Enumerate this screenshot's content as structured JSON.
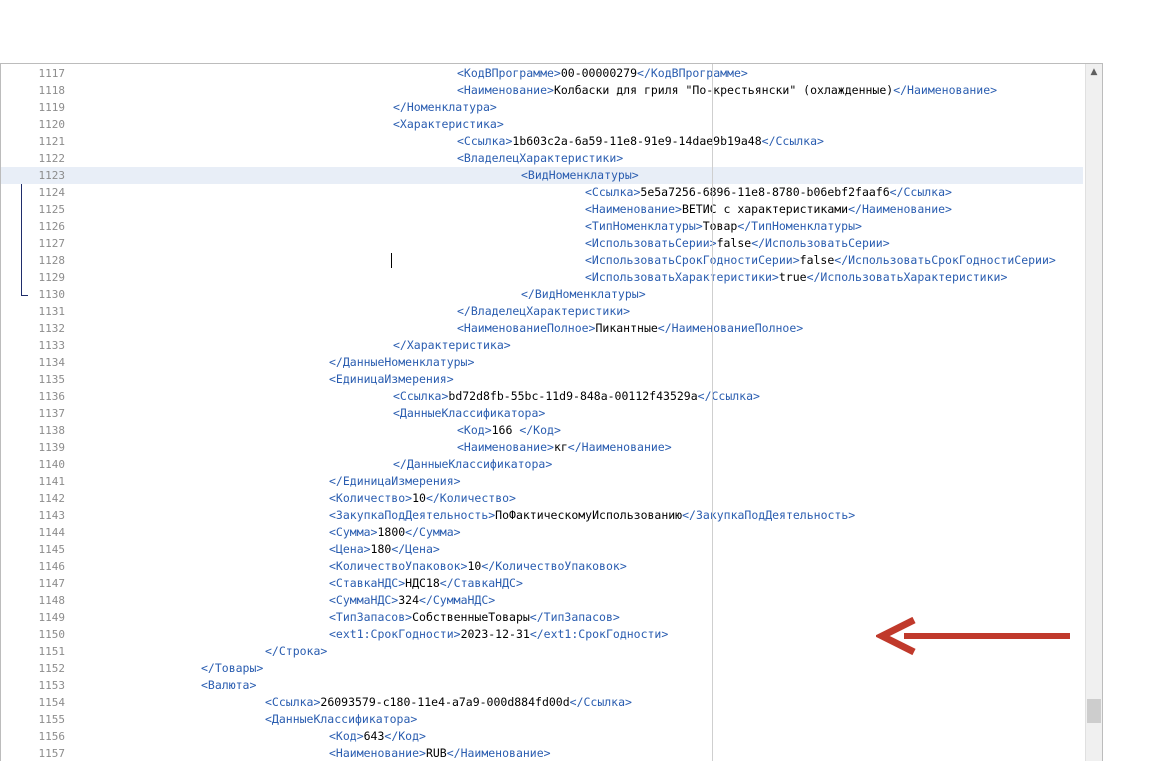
{
  "editor": {
    "lines": [
      {
        "n": "1117",
        "i": 7,
        "segs": [
          [
            "t",
            "<КодВПрограмме>"
          ],
          [
            "x",
            "00-00000279"
          ],
          [
            "t",
            "</КодВПрограмме>"
          ]
        ]
      },
      {
        "n": "1118",
        "i": 7,
        "segs": [
          [
            "t",
            "<Наименование>"
          ],
          [
            "x",
            "Колбаски для гриля \"По-крестьянски\" (охлажденные)"
          ],
          [
            "t",
            "</Наименование>"
          ]
        ]
      },
      {
        "n": "1119",
        "i": 6,
        "segs": [
          [
            "t",
            "</Номенклатура>"
          ]
        ]
      },
      {
        "n": "1120",
        "i": 6,
        "segs": [
          [
            "t",
            "<Характеристика>"
          ]
        ]
      },
      {
        "n": "1121",
        "i": 7,
        "segs": [
          [
            "t",
            "<Ссылка>"
          ],
          [
            "x",
            "1b603c2a-6a59-11e8-91e9-14dae9b19a48"
          ],
          [
            "t",
            "</Ссылка>"
          ]
        ]
      },
      {
        "n": "1122",
        "i": 7,
        "segs": [
          [
            "t",
            "<ВладелецХарактеристики>"
          ]
        ]
      },
      {
        "n": "1123",
        "i": 8,
        "hl": true,
        "segs": [
          [
            "t",
            "<ВидНоменклатуры>"
          ]
        ]
      },
      {
        "n": "1124",
        "i": 9,
        "segs": [
          [
            "t",
            "<Ссылка>"
          ],
          [
            "x",
            "5e5a7256-6896-11e8-8780-b06ebf2faaf6"
          ],
          [
            "t",
            "</Ссылка>"
          ]
        ]
      },
      {
        "n": "1125",
        "i": 9,
        "segs": [
          [
            "t",
            "<Наименование>"
          ],
          [
            "x",
            "ВЕТИС с характеристиками"
          ],
          [
            "t",
            "</Наименование>"
          ]
        ]
      },
      {
        "n": "1126",
        "i": 9,
        "segs": [
          [
            "t",
            "<ТипНоменклатуры>"
          ],
          [
            "x",
            "Товар"
          ],
          [
            "t",
            "</ТипНоменклатуры>"
          ]
        ]
      },
      {
        "n": "1127",
        "i": 9,
        "segs": [
          [
            "t",
            "<ИспользоватьСерии>"
          ],
          [
            "x",
            "false"
          ],
          [
            "t",
            "</ИспользоватьСерии>"
          ]
        ]
      },
      {
        "n": "1128",
        "i": 9,
        "segs": [
          [
            "t",
            "<ИспользоватьСрокГодностиСерии>"
          ],
          [
            "x",
            "false"
          ],
          [
            "t",
            "</ИспользоватьСрокГодностиСерии>"
          ]
        ]
      },
      {
        "n": "1129",
        "i": 9,
        "segs": [
          [
            "t",
            "<ИспользоватьХарактеристики>"
          ],
          [
            "x",
            "true"
          ],
          [
            "t",
            "</ИспользоватьХарактеристики>"
          ]
        ]
      },
      {
        "n": "1130",
        "i": 8,
        "segs": [
          [
            "t",
            "</ВидНоменклатуры>"
          ]
        ]
      },
      {
        "n": "1131",
        "i": 7,
        "segs": [
          [
            "t",
            "</ВладелецХарактеристики>"
          ]
        ]
      },
      {
        "n": "1132",
        "i": 7,
        "segs": [
          [
            "t",
            "<НаименованиеПолное>"
          ],
          [
            "x",
            "Пикантные"
          ],
          [
            "t",
            "</НаименованиеПолное>"
          ]
        ]
      },
      {
        "n": "1133",
        "i": 6,
        "segs": [
          [
            "t",
            "</Характеристика>"
          ]
        ]
      },
      {
        "n": "1134",
        "i": 5,
        "segs": [
          [
            "t",
            "</ДанныеНоменклатуры>"
          ]
        ]
      },
      {
        "n": "1135",
        "i": 5,
        "segs": [
          [
            "t",
            "<ЕдиницаИзмерения>"
          ]
        ]
      },
      {
        "n": "1136",
        "i": 6,
        "segs": [
          [
            "t",
            "<Ссылка>"
          ],
          [
            "x",
            "bd72d8fb-55bc-11d9-848a-00112f43529a"
          ],
          [
            "t",
            "</Ссылка>"
          ]
        ]
      },
      {
        "n": "1137",
        "i": 6,
        "segs": [
          [
            "t",
            "<ДанныеКлассификатора>"
          ]
        ]
      },
      {
        "n": "1138",
        "i": 7,
        "segs": [
          [
            "t",
            "<Код>"
          ],
          [
            "x",
            "166 "
          ],
          [
            "t",
            "</Код>"
          ]
        ]
      },
      {
        "n": "1139",
        "i": 7,
        "segs": [
          [
            "t",
            "<Наименование>"
          ],
          [
            "x",
            "кг"
          ],
          [
            "t",
            "</Наименование>"
          ]
        ]
      },
      {
        "n": "1140",
        "i": 6,
        "segs": [
          [
            "t",
            "</ДанныеКлассификатора>"
          ]
        ]
      },
      {
        "n": "1141",
        "i": 5,
        "segs": [
          [
            "t",
            "</ЕдиницаИзмерения>"
          ]
        ]
      },
      {
        "n": "1142",
        "i": 5,
        "segs": [
          [
            "t",
            "<Количество>"
          ],
          [
            "x",
            "10"
          ],
          [
            "t",
            "</Количество>"
          ]
        ]
      },
      {
        "n": "1143",
        "i": 5,
        "segs": [
          [
            "t",
            "<ЗакупкаПодДеятельность>"
          ],
          [
            "x",
            "ПоФактическомуИспользованию"
          ],
          [
            "t",
            "</ЗакупкаПодДеятельность>"
          ]
        ]
      },
      {
        "n": "1144",
        "i": 5,
        "segs": [
          [
            "t",
            "<Сумма>"
          ],
          [
            "x",
            "1800"
          ],
          [
            "t",
            "</Сумма>"
          ]
        ]
      },
      {
        "n": "1145",
        "i": 5,
        "segs": [
          [
            "t",
            "<Цена>"
          ],
          [
            "x",
            "180"
          ],
          [
            "t",
            "</Цена>"
          ]
        ]
      },
      {
        "n": "1146",
        "i": 5,
        "segs": [
          [
            "t",
            "<КоличествоУпаковок>"
          ],
          [
            "x",
            "10"
          ],
          [
            "t",
            "</КоличествоУпаковок>"
          ]
        ]
      },
      {
        "n": "1147",
        "i": 5,
        "segs": [
          [
            "t",
            "<СтавкаНДС>"
          ],
          [
            "x",
            "НДС18"
          ],
          [
            "t",
            "</СтавкаНДС>"
          ]
        ]
      },
      {
        "n": "1148",
        "i": 5,
        "segs": [
          [
            "t",
            "<СуммаНДС>"
          ],
          [
            "x",
            "324"
          ],
          [
            "t",
            "</СуммаНДС>"
          ]
        ]
      },
      {
        "n": "1149",
        "i": 5,
        "segs": [
          [
            "t",
            "<ТипЗапасов>"
          ],
          [
            "x",
            "СобственныеТовары"
          ],
          [
            "t",
            "</ТипЗапасов>"
          ]
        ]
      },
      {
        "n": "1150",
        "i": 5,
        "segs": [
          [
            "t",
            "<ext1:СрокГодности>"
          ],
          [
            "x",
            "2023-12-31"
          ],
          [
            "t",
            "</ext1:СрокГодности>"
          ]
        ]
      },
      {
        "n": "1151",
        "i": 4,
        "segs": [
          [
            "t",
            "</Строка>"
          ]
        ]
      },
      {
        "n": "1152",
        "i": 3,
        "segs": [
          [
            "t",
            "</Товары>"
          ]
        ]
      },
      {
        "n": "1153",
        "i": 3,
        "segs": [
          [
            "t",
            "<Валюта>"
          ]
        ]
      },
      {
        "n": "1154",
        "i": 4,
        "segs": [
          [
            "t",
            "<Ссылка>"
          ],
          [
            "x",
            "26093579-c180-11e4-a7a9-000d884fd00d"
          ],
          [
            "t",
            "</Ссылка>"
          ]
        ]
      },
      {
        "n": "1155",
        "i": 4,
        "segs": [
          [
            "t",
            "<ДанныеКлассификатора>"
          ]
        ]
      },
      {
        "n": "1156",
        "i": 5,
        "segs": [
          [
            "t",
            "<Код>"
          ],
          [
            "x",
            "643"
          ],
          [
            "t",
            "</Код>"
          ]
        ]
      },
      {
        "n": "1157",
        "i": 5,
        "segs": [
          [
            "t",
            "<Наименование>"
          ],
          [
            "x",
            "RUB"
          ],
          [
            "t",
            "</Наименование>"
          ]
        ]
      }
    ]
  },
  "annotation": {
    "arrow_color": "#c0392b"
  },
  "colors": {
    "tag": "#2a5db0",
    "text": "#000000",
    "line_number": "#8c8c8c",
    "highlight": "#e8eef7"
  }
}
